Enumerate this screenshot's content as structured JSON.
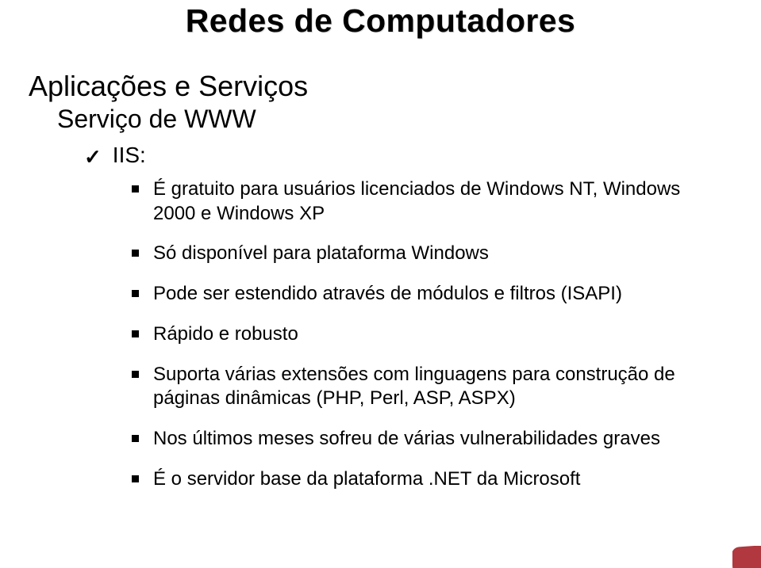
{
  "title": "Redes de Computadores",
  "subtitle": "Aplicações e Serviços",
  "subsubtitle": "Serviço de WWW",
  "check_item": "IIS:",
  "details": [
    "É gratuito para usuários licenciados de Windows NT, Windows 2000 e Windows XP",
    "Só disponível para plataforma Windows",
    "Pode ser estendido através de módulos e filtros (ISAPI)",
    "Rápido e robusto",
    "Suporta várias extensões com linguagens para construção de páginas dinâmicas (PHP, Perl, ASP, ASPX)",
    "Nos últimos meses sofreu de várias vulnerabilidades graves",
    "É o servidor base da plataforma .NET da Microsoft"
  ]
}
